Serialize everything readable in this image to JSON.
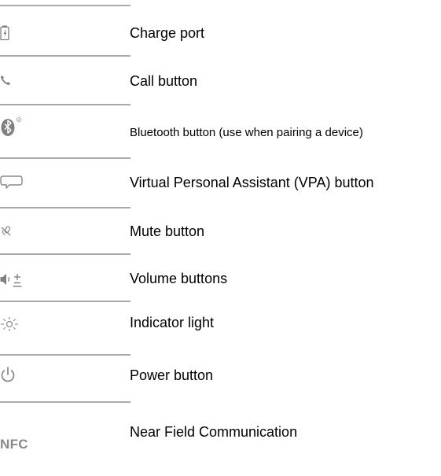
{
  "items": [
    {
      "icon": "battery-charge-icon",
      "label": "Charge port"
    },
    {
      "icon": "phone-icon",
      "label": "Call button"
    },
    {
      "icon": "bluetooth-icon",
      "label": "Bluetooth button (use when pairing a device)"
    },
    {
      "icon": "speech-bubble-icon",
      "label": "Virtual Personal Assistant (VPA) button"
    },
    {
      "icon": "mute-microphone-icon",
      "label": "Mute button"
    },
    {
      "icon": "volume-plus-minus-icon",
      "label": "Volume buttons"
    },
    {
      "icon": "indicator-light-icon",
      "label": "Indicator light"
    },
    {
      "icon": "power-icon",
      "label": "Power button"
    },
    {
      "icon": "nfc-icon",
      "icon_text": "NFC",
      "label": "Near Field Communication"
    }
  ]
}
